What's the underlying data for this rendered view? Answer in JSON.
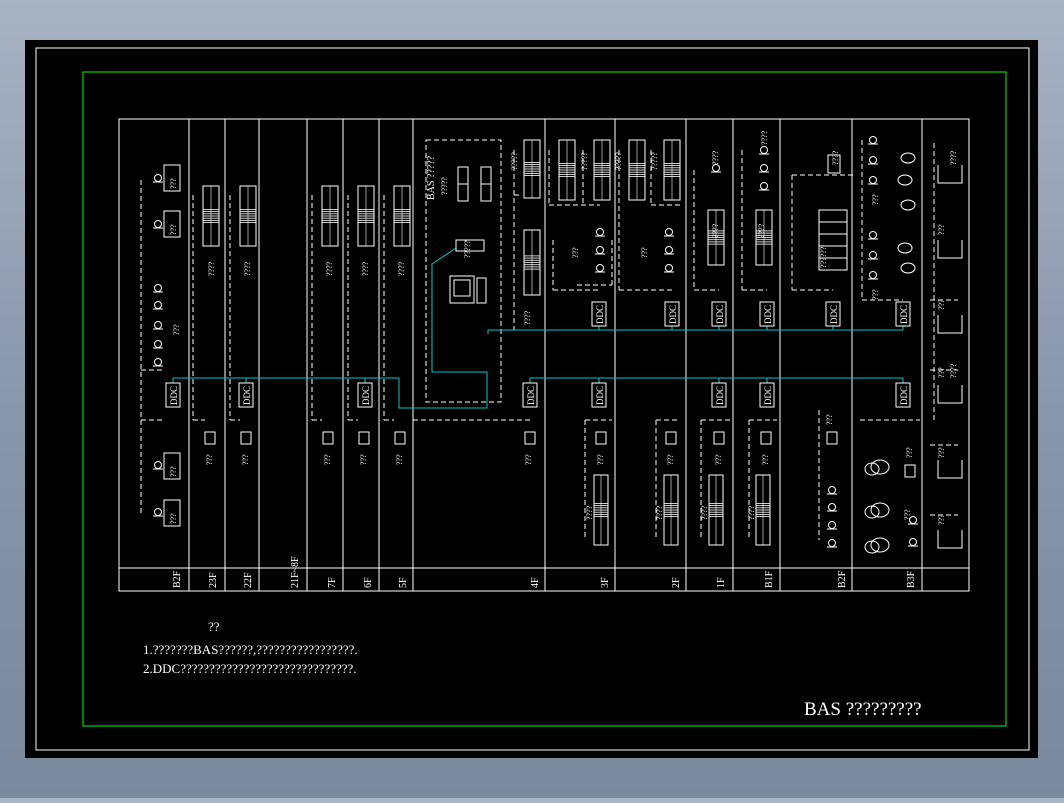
{
  "drawing": {
    "title": "BAS ?????????",
    "notes_heading": "??",
    "notes": [
      "1.???????BAS??????,?????????????????.",
      "2.DDC??????????????????????????????."
    ],
    "ddc_label": "DDC",
    "bas_label": "BAS ?????",
    "colors": {
      "background": "#000000",
      "line": "#ffffff",
      "inner_border": "#00ff00",
      "bus": "#00c8c8"
    }
  },
  "floors": [
    "B2F",
    "23F",
    "22F",
    "21F~8F",
    "7F",
    "6F",
    "5F",
    "4F",
    "3F",
    "2F",
    "1F",
    "B1F",
    "B2F",
    "B3F",
    ""
  ],
  "labels": {
    "q2": "??",
    "q3": "???",
    "q4": "????",
    "q5": "?????",
    "q6": "??????"
  }
}
